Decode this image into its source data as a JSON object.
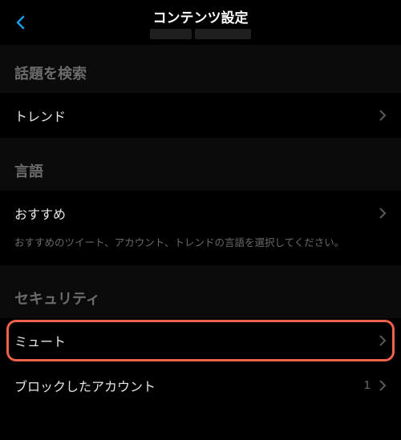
{
  "header": {
    "title": "コンテンツ設定"
  },
  "sections": {
    "search": {
      "header": "話題を検索",
      "trends_label": "トレンド"
    },
    "language": {
      "header": "言語",
      "recommend_label": "おすすめ",
      "recommend_desc": "おすすめのツイート、アカウント、トレンドの言語を選択してください。"
    },
    "security": {
      "header": "セキュリティ",
      "mute_label": "ミュート",
      "blocked_label": "ブロックしたアカウント",
      "blocked_count": "1"
    }
  }
}
